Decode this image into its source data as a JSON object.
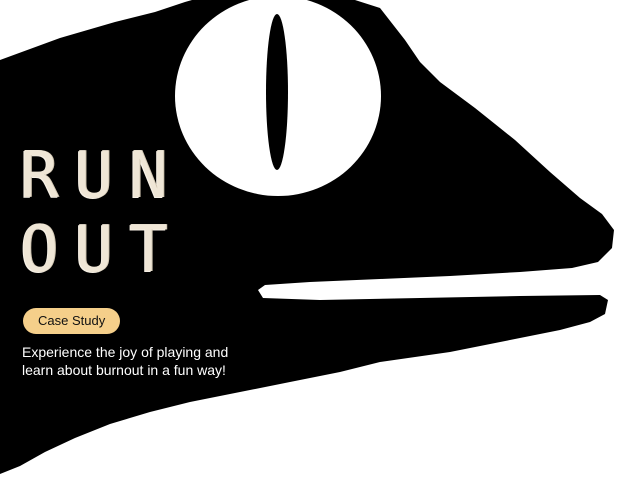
{
  "hero": {
    "title_line_1": "RUN",
    "title_line_2": "OUT",
    "badge_label": "Case Study",
    "tagline_line_1": "Experience the joy of playing and",
    "tagline_line_2": "learn about burnout in a fun way!"
  },
  "colors": {
    "background": "#ffffff",
    "creature": "#000000",
    "eye": "#ffffff",
    "title": "#efe6d6",
    "badge": "#f5cf8a",
    "tagline": "#ffffff"
  },
  "icons": [
    "lizard-head-illustration",
    "eye-icon"
  ]
}
